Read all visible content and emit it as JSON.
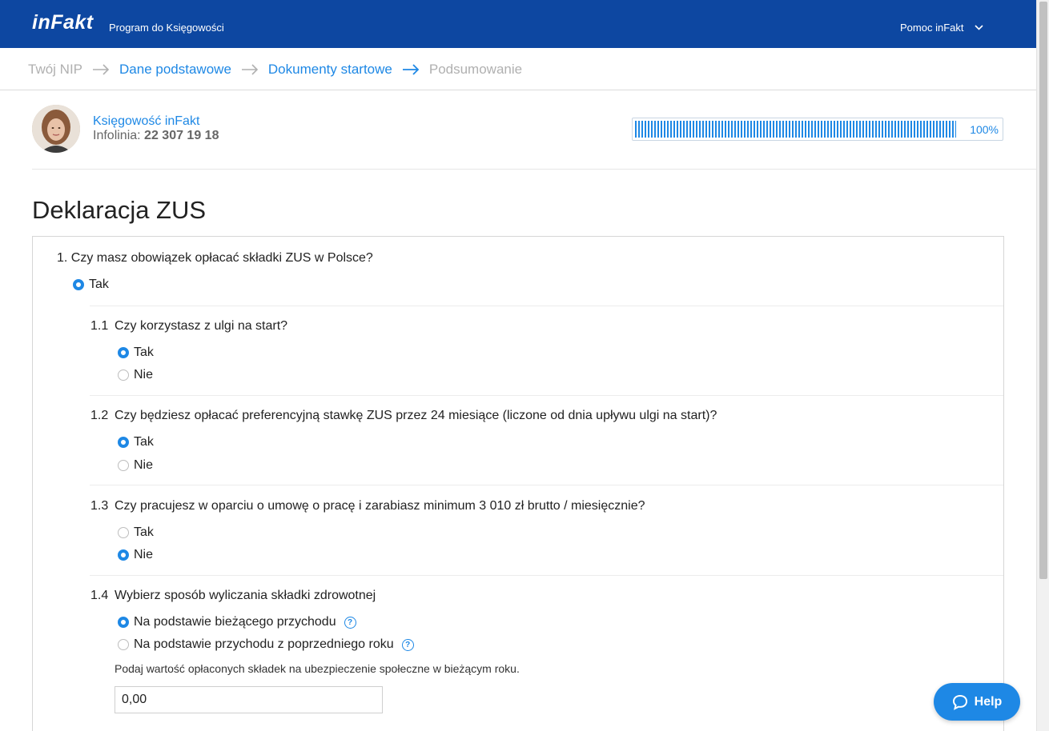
{
  "header": {
    "logo": "inFakt",
    "app_title": "Program do Księgowości",
    "help_menu": "Pomoc inFakt"
  },
  "steps": [
    {
      "label": "Twój NIP",
      "state": "done"
    },
    {
      "label": "Dane podstawowe",
      "state": "active"
    },
    {
      "label": "Dokumenty startowe",
      "state": "active"
    },
    {
      "label": "Podsumowanie",
      "state": "todo"
    }
  ],
  "accountant": {
    "name": "Księgowość inFakt",
    "phone_label": "Infolinia:",
    "phone": "22 307 19 18"
  },
  "progress": {
    "value": 1.0,
    "label": "100%"
  },
  "page_title": "Deklaracja ZUS",
  "form": {
    "q1": {
      "text": "1. Czy masz obowiązek opłacać składki ZUS w Polsce?",
      "options": [
        {
          "label": "Tak",
          "checked": true
        }
      ]
    },
    "q1_1": {
      "num": "1.1",
      "text": "Czy korzystasz z ulgi na start?",
      "options": [
        {
          "label": "Tak",
          "checked": true
        },
        {
          "label": "Nie",
          "checked": false
        }
      ]
    },
    "q1_2": {
      "num": "1.2",
      "text": "Czy będziesz opłacać preferencyjną stawkę ZUS przez 24 miesiące (liczone od dnia upływu ulgi na start)?",
      "options": [
        {
          "label": "Tak",
          "checked": true
        },
        {
          "label": "Nie",
          "checked": false
        }
      ]
    },
    "q1_3": {
      "num": "1.3",
      "text": "Czy pracujesz w oparciu o umowę o pracę i zarabiasz minimum 3 010 zł brutto / miesięcznie?",
      "options": [
        {
          "label": "Tak",
          "checked": false
        },
        {
          "label": "Nie",
          "checked": true
        }
      ]
    },
    "q1_4": {
      "num": "1.4",
      "text": "Wybierz sposób wyliczania składki zdrowotnej",
      "options": [
        {
          "label": "Na podstawie bieżącego przychodu",
          "checked": true
        },
        {
          "label": "Na podstawie przychodu z poprzedniego roku",
          "checked": false
        }
      ],
      "hint_icon": "?",
      "field_label": "Podaj wartość opłaconych składek na ubezpieczenie społeczne w bieżącym roku.",
      "field_value": "0,00"
    }
  },
  "help_button": "Help",
  "colors": {
    "brand": "#0d47a1",
    "accent": "#1e88e5"
  }
}
